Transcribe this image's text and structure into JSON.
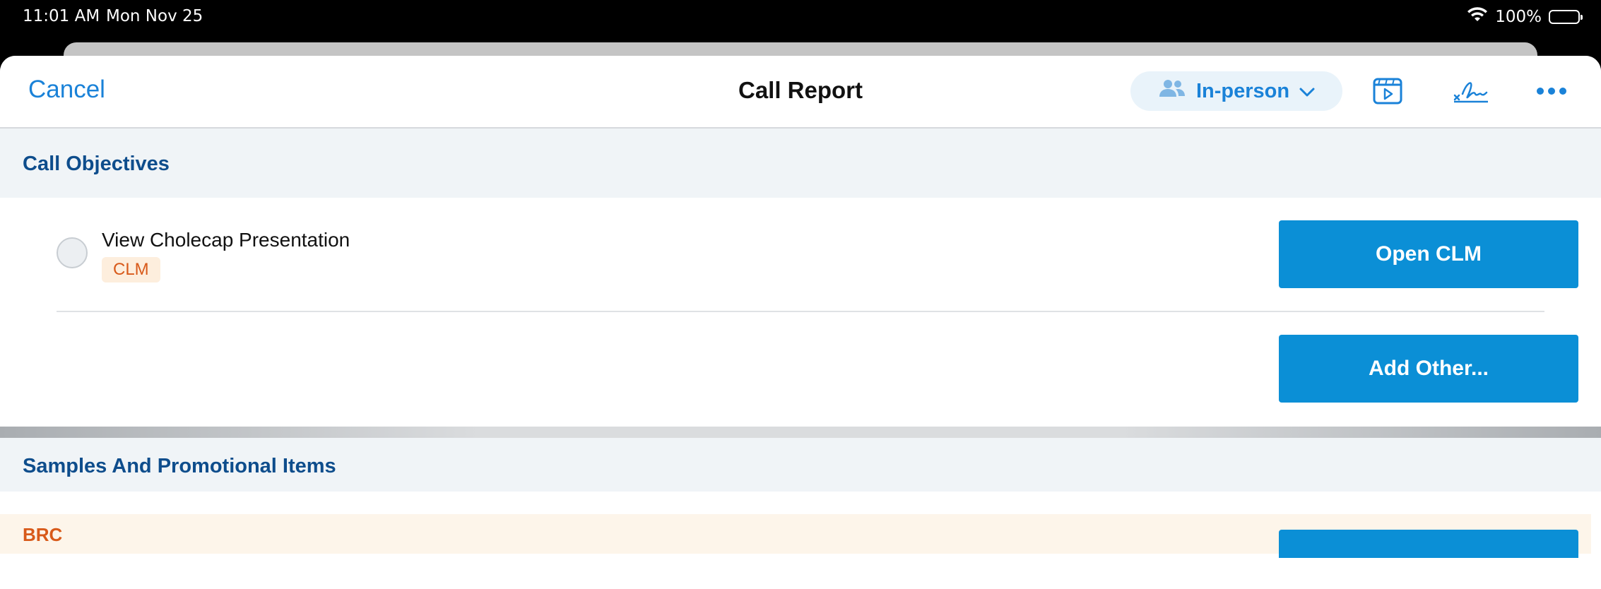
{
  "status_bar": {
    "time": "11:01 AM",
    "date": "Mon Nov 25",
    "battery": "100%"
  },
  "navbar": {
    "cancel_label": "Cancel",
    "title": "Call Report",
    "mode_label": "In-person",
    "icons": [
      "people-icon",
      "chevron-down-icon",
      "media-player-icon",
      "signature-icon",
      "more-icon"
    ]
  },
  "call_objectives": {
    "header": "Call Objectives",
    "items": [
      {
        "title": "View Cholecap Presentation",
        "badge": "CLM",
        "action_label": "Open CLM"
      }
    ],
    "add_label": "Add Other..."
  },
  "samples": {
    "header": "Samples And Promotional Items",
    "group_label": "BRC"
  },
  "colors": {
    "accent": "#1a82d8",
    "button": "#0b8fd6",
    "section_header_text": "#0e4d8c",
    "badge_text": "#d85a1a"
  }
}
